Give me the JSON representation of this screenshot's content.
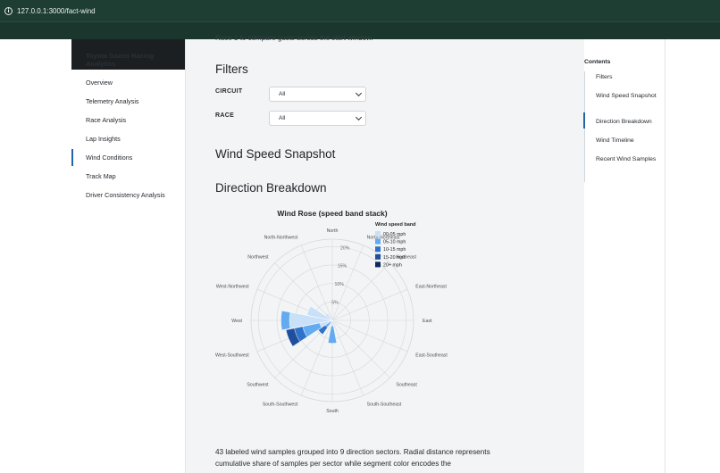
{
  "browser": {
    "url": "127.0.0.1:3000/fact-wind"
  },
  "sidebar": {
    "brand": [
      "Toyota Gazoo Racing",
      "Analytics"
    ],
    "items": [
      {
        "label": "Overview",
        "active": false
      },
      {
        "label": "Telemetry Analysis",
        "active": false
      },
      {
        "label": "Race Analysis",
        "active": false
      },
      {
        "label": "Lap Insights",
        "active": false
      },
      {
        "label": "Wind Conditions",
        "active": true
      },
      {
        "label": "Track Map",
        "active": false
      },
      {
        "label": "Driver Consistency Analysis",
        "active": false
      }
    ]
  },
  "main": {
    "cut_text": "Race 1 to compare gusts across the start window.",
    "filters_heading": "Filters",
    "filters": [
      {
        "label": "CIRCUIT",
        "value": "All"
      },
      {
        "label": "RACE",
        "value": "All"
      }
    ],
    "snapshot_heading": "Wind Speed Snapshot",
    "direction_heading": "Direction Breakdown",
    "description": "43 labeled wind samples grouped into 9 direction sectors. Radial distance represents cumulative share of samples per sector while segment color encodes the"
  },
  "toc": {
    "title": "Contents",
    "items": [
      {
        "label": "Filters",
        "active": false
      },
      {
        "label": "Wind Speed Snapshot",
        "active": false
      },
      {
        "label": "Direction Breakdown",
        "active": true
      },
      {
        "label": "Wind Timeline",
        "active": false
      },
      {
        "label": "Recent Wind Samples",
        "active": false
      }
    ]
  },
  "chart_data": {
    "type": "barpolar",
    "title": "Wind Rose (speed band stack)",
    "directions": [
      "North",
      "North-Northeast",
      "Northeast",
      "East-Northeast",
      "East",
      "East-Southeast",
      "Southeast",
      "South-Southeast",
      "South",
      "South-Southwest",
      "Southwest",
      "West-Southwest",
      "West",
      "West-Northwest",
      "Northwest",
      "North-Northwest"
    ],
    "radial_ticks": [
      5,
      10,
      15,
      20
    ],
    "radial_tick_labels": [
      "5%",
      "10%",
      "15%",
      "20%"
    ],
    "radial_max": 22,
    "legend_title": "Wind speed band",
    "legend_position": "top-right",
    "series": [
      {
        "name": "00-05 mph",
        "color": "#c8e0f8",
        "values": [
          0,
          0,
          0,
          0,
          0.3,
          0.8,
          0,
          0,
          1.5,
          0,
          0,
          3.5,
          11.6,
          7.0,
          2.3,
          0
        ]
      },
      {
        "name": "05-10 mph",
        "color": "#64aaf0",
        "values": [
          0,
          0,
          0,
          0,
          0,
          0,
          0,
          0,
          4.7,
          0,
          2.3,
          4.7,
          2.3,
          0,
          0,
          0
        ]
      },
      {
        "name": "10-15 mph",
        "color": "#2f73c9",
        "values": [
          0,
          0,
          0,
          0,
          0,
          0,
          0,
          0,
          0,
          0,
          2.3,
          2.3,
          0,
          0,
          0,
          0
        ]
      },
      {
        "name": "15-20 mph",
        "color": "#1f4e9c",
        "values": [
          0,
          0,
          0,
          0,
          0,
          0,
          0,
          0,
          0,
          0,
          0,
          2.3,
          0,
          0,
          0,
          0
        ]
      },
      {
        "name": "20+ mph",
        "color": "#0d2a5c",
        "values": [
          0,
          0,
          0,
          0,
          0,
          0,
          0,
          0,
          0,
          0,
          0,
          0,
          0,
          0,
          0,
          0
        ]
      }
    ]
  }
}
